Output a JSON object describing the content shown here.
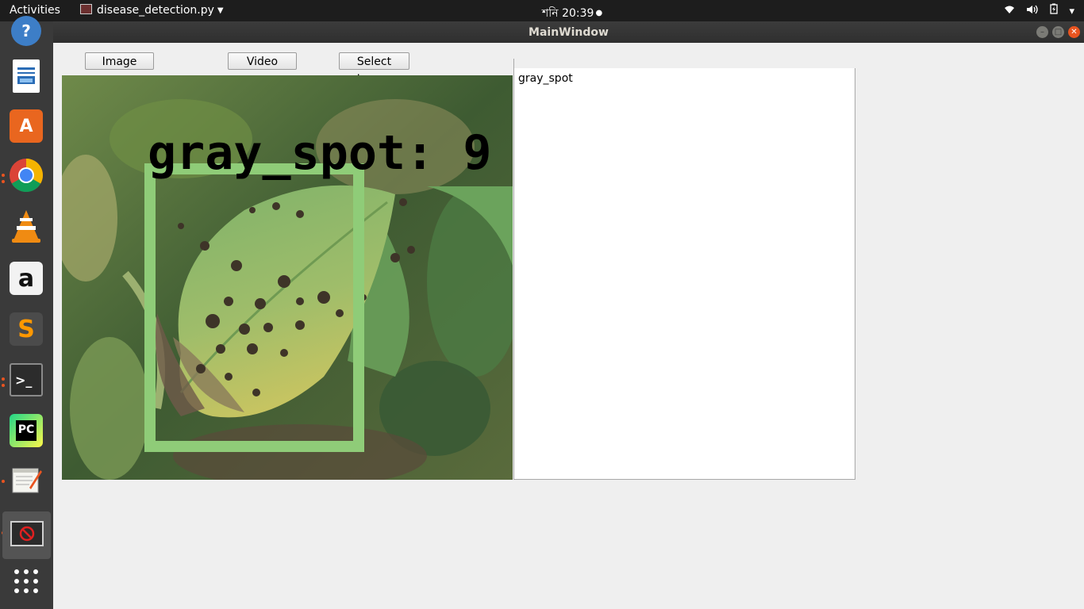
{
  "topbar": {
    "activities": "Activities",
    "app_name": "disease_detection.py",
    "clock": "শনি 20:39",
    "tray_icons": [
      "wifi-icon",
      "volume-icon",
      "battery-icon",
      "power-menu-icon"
    ]
  },
  "dock": {
    "items": [
      {
        "name": "help",
        "icon": "help-icon"
      },
      {
        "name": "libreoffice-writer",
        "icon": "writer-icon"
      },
      {
        "name": "ubuntu-software",
        "icon": "software-icon",
        "label": "A"
      },
      {
        "name": "google-chrome",
        "icon": "chrome-icon"
      },
      {
        "name": "vlc",
        "icon": "vlc-icon"
      },
      {
        "name": "amazon",
        "icon": "amazon-icon",
        "label": "a"
      },
      {
        "name": "sublime-text",
        "icon": "sublime-icon",
        "label": "S"
      },
      {
        "name": "terminal",
        "icon": "terminal-icon",
        "label": ">_"
      },
      {
        "name": "pycharm",
        "icon": "pycharm-icon",
        "label": "PC"
      },
      {
        "name": "text-editor",
        "icon": "text-editor-icon"
      },
      {
        "name": "python-window",
        "icon": "active-app-icon"
      },
      {
        "name": "show-applications",
        "icon": "app-grid-icon"
      }
    ]
  },
  "window": {
    "title": "MainWindow",
    "buttons": {
      "image": "Image",
      "video": "Video",
      "select_image": "Select Image"
    },
    "detection": {
      "overlay_text": "gray_spot: 9",
      "box_color": "#8fcc78"
    },
    "result_text": "gray_spot"
  },
  "colors": {
    "topbar_bg": "#1d1d1d",
    "dock_bg": "#3a3a3a",
    "window_bg": "#efefef",
    "close_button": "#e9541f",
    "running_indicator": "#e95420"
  }
}
